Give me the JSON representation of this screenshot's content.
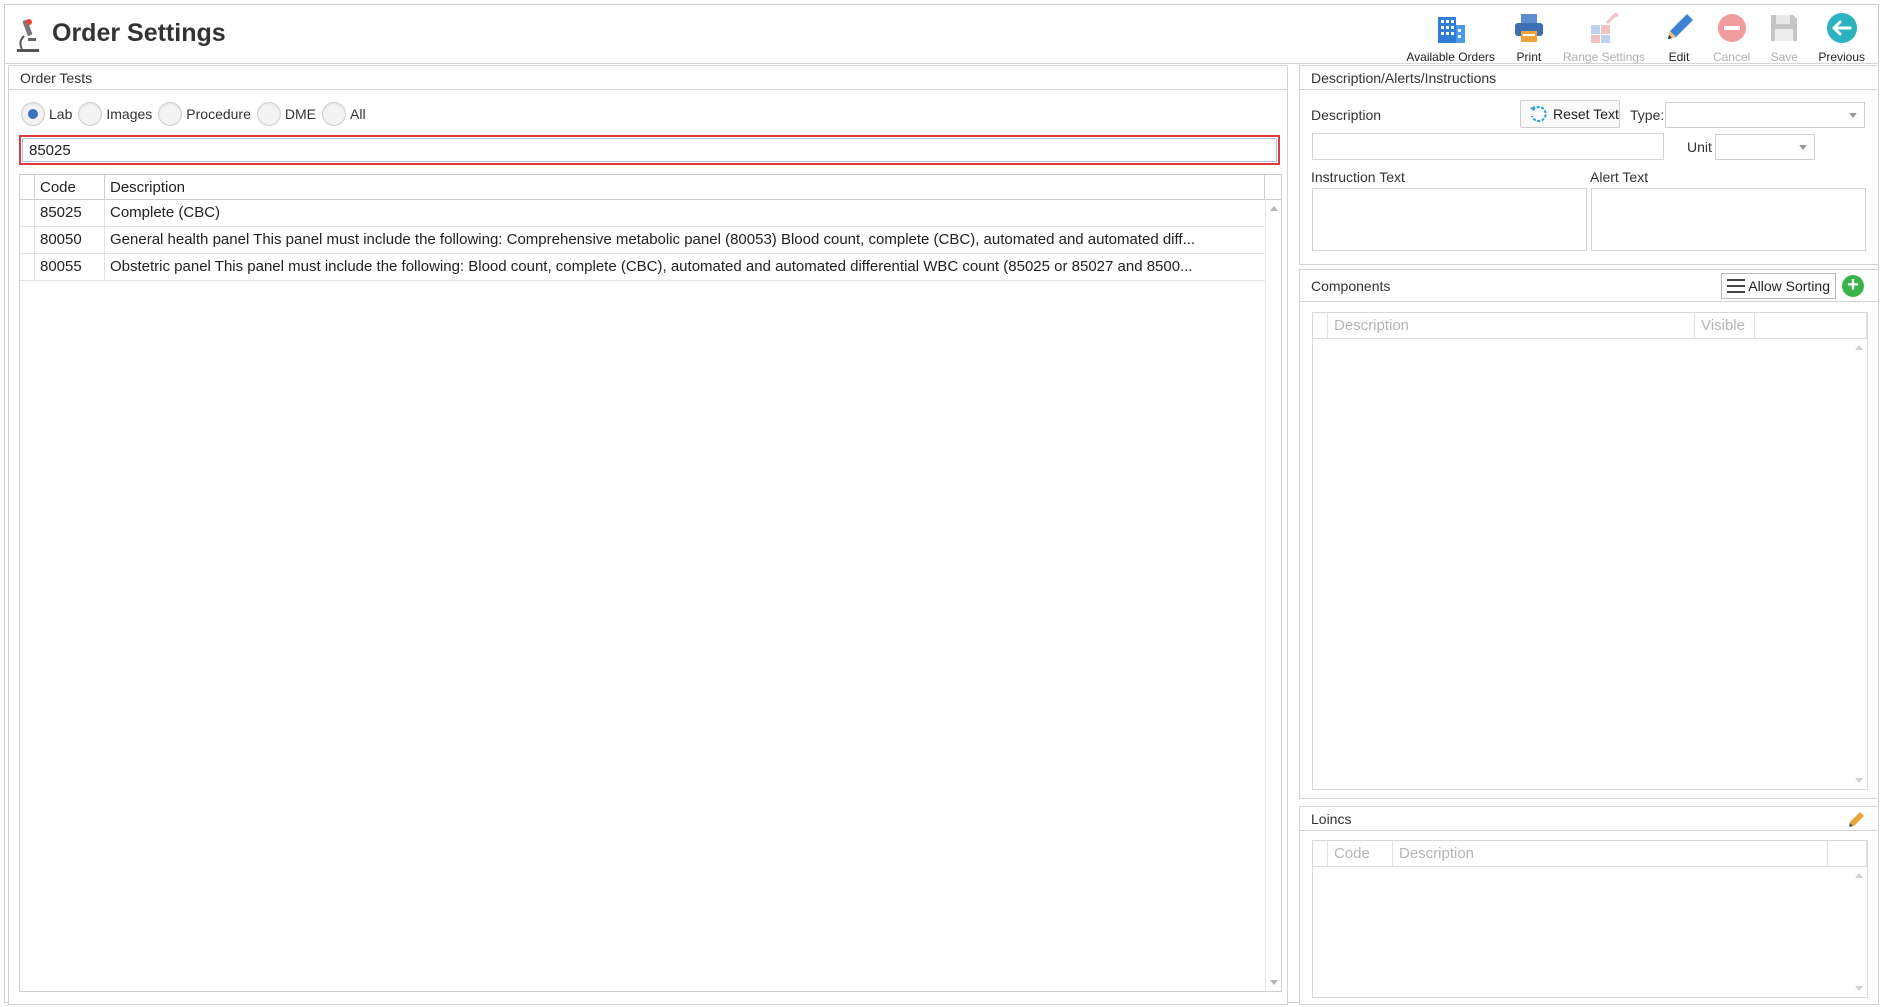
{
  "app": {
    "title": "Order Settings",
    "icon": "microscope-icon"
  },
  "toolbar": {
    "available_orders": {
      "label": "Available Orders",
      "icon": "building-icon"
    },
    "print": {
      "label": "Print",
      "icon": "printer-icon"
    },
    "range_settings": {
      "label": "Range Settings",
      "icon": "range-settings-icon",
      "disabled": true
    },
    "edit": {
      "label": "Edit",
      "icon": "pencil-icon"
    },
    "cancel": {
      "label": "Cancel",
      "icon": "cancel-icon",
      "disabled": true
    },
    "save": {
      "label": "Save",
      "icon": "floppy-icon",
      "disabled": true
    },
    "previous": {
      "label": "Previous",
      "icon": "arrow-left-icon"
    }
  },
  "order_tests": {
    "title": "Order Tests",
    "filters": [
      {
        "label": "Lab",
        "checked": true
      },
      {
        "label": "Images",
        "checked": false
      },
      {
        "label": "Procedure",
        "checked": false
      },
      {
        "label": "DME",
        "checked": false
      },
      {
        "label": "All",
        "checked": false
      }
    ],
    "search_value": "85025",
    "columns": {
      "code": "Code",
      "description": "Description"
    },
    "rows": [
      {
        "code": "85025",
        "description": "Complete (CBC)"
      },
      {
        "code": "80050",
        "description": "General health panel This panel must include the following: Comprehensive metabolic panel (80053) Blood count, complete (CBC), automated and automated diff..."
      },
      {
        "code": "80055",
        "description": "Obstetric panel This panel must include the following: Blood count, complete (CBC), automated and automated differential WBC count (85025 or 85027 and 8500..."
      }
    ]
  },
  "desc_panel": {
    "title": "Description/Alerts/Instructions",
    "description_label": "Description",
    "reset_text": "Reset Text",
    "type_label": "Type:",
    "type_value": "",
    "unit_label": "Unit",
    "unit_value": "",
    "instruction_label": "Instruction Text",
    "alert_label": "Alert Text"
  },
  "components": {
    "title": "Components",
    "allow_sorting": "Allow Sorting",
    "col_description": "Description",
    "col_visible": "Visible"
  },
  "loincs": {
    "title": "Loincs",
    "col_code": "Code",
    "col_description": "Description"
  },
  "colors": {
    "accent_blue": "#3f6fc4",
    "search_border": "#e03a3a",
    "add_green": "#3bb34a",
    "previous_teal": "#2bb3c0"
  }
}
